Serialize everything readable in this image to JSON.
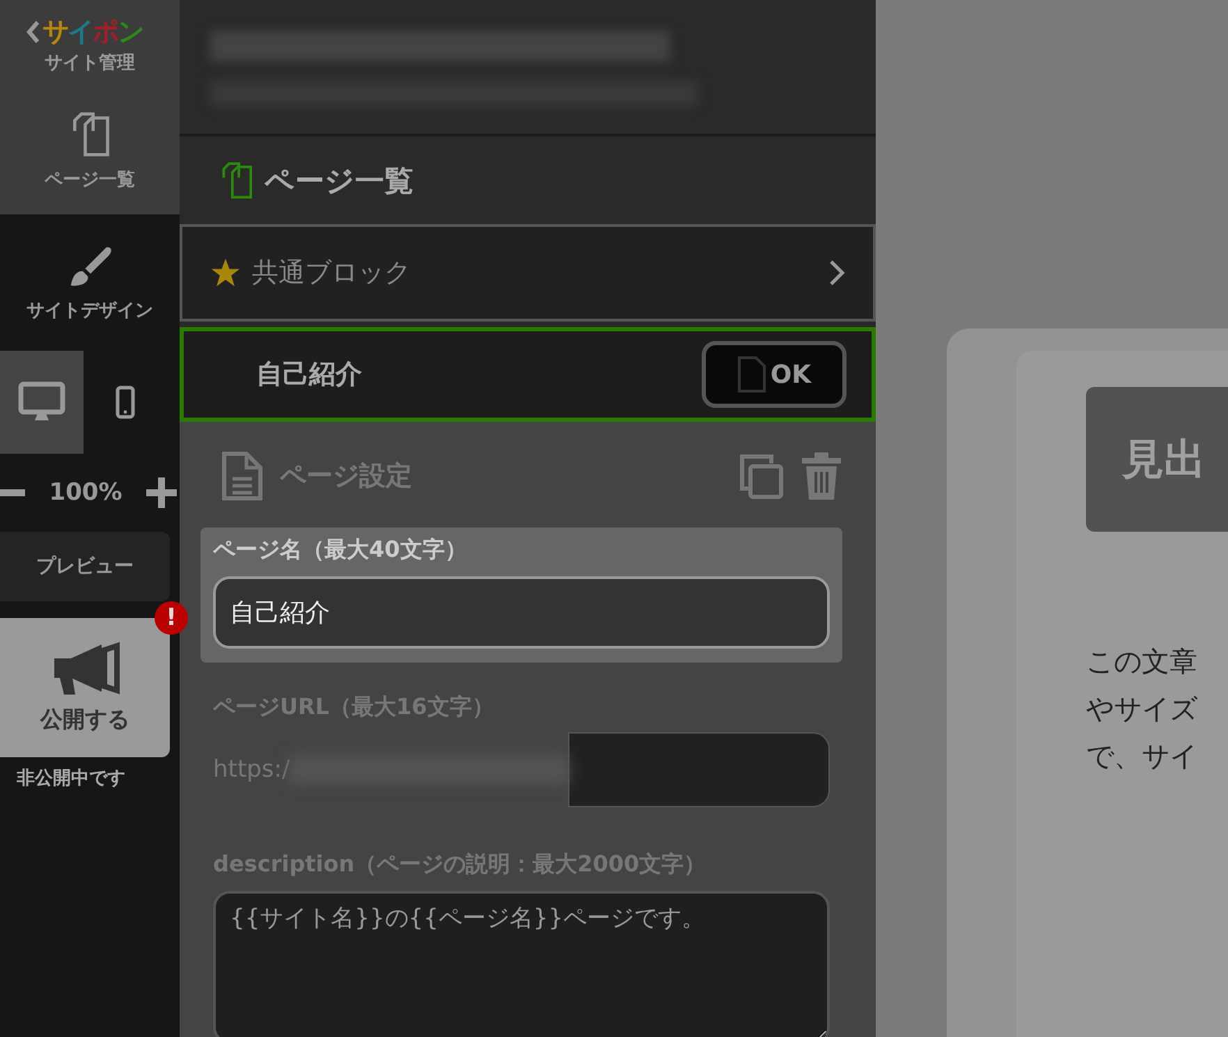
{
  "sidebar": {
    "logo": "サイポン",
    "site_admin": "サイト管理",
    "nav": [
      {
        "label": "ページ一覧",
        "kind": "pages",
        "selected": true
      },
      {
        "label": "サイトデザイン",
        "kind": "brush",
        "selected": false
      }
    ],
    "devices": [
      {
        "kind": "desktop",
        "selected": true
      },
      {
        "kind": "mobile",
        "selected": false
      }
    ],
    "zoom": "100%",
    "preview_button": "プレビュー",
    "publish_button": "公開する",
    "publish_alert": "!",
    "publish_status": "非公開中です"
  },
  "panel": {
    "title": "ページ一覧",
    "common_block": "共通ブロック",
    "pages": [
      {
        "label": "自己紹介",
        "selected": true,
        "button": "OK"
      }
    ],
    "settings": {
      "title": "ページ設定",
      "fields": [
        {
          "kind": "text",
          "label": "ページ名（最大40文字）",
          "value": "自己紹介",
          "focused": true
        },
        {
          "kind": "url",
          "label": "ページURL（最大16文字）",
          "prefix": "https:/",
          "focused": false
        },
        {
          "kind": "textarea",
          "label": "description（ページの説明：最大2000文字）",
          "value": "{{サイト名}}の{{ページ名}}ページです。",
          "focused": false
        }
      ]
    }
  },
  "preview": {
    "heading": "見出",
    "body_lines": [
      "この文章",
      "やサイズ",
      "で、サイ"
    ]
  }
}
